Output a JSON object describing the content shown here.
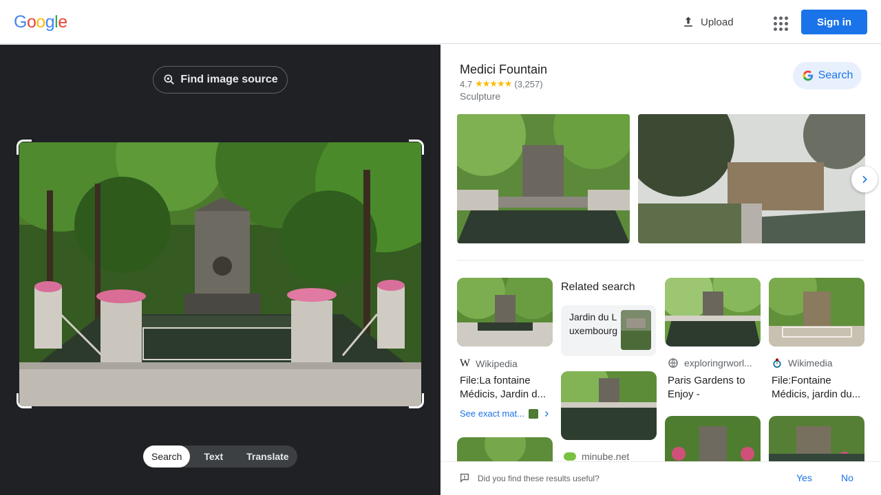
{
  "header": {
    "logo": "Google",
    "upload_label": "Upload",
    "signin_label": "Sign in"
  },
  "left": {
    "find_source_label": "Find image source",
    "modes": [
      "Search",
      "Text",
      "Translate"
    ],
    "active_mode": "Search"
  },
  "knowledge_panel": {
    "title": "Medici Fountain",
    "rating": "4.7",
    "stars": "★★★★★",
    "review_count": "(3,257)",
    "type": "Sculpture",
    "search_label": "Search"
  },
  "results": {
    "col1": {
      "source": "Wikipedia",
      "title_line1": "File:La fontaine",
      "title_line2": "Médicis, Jardin d...",
      "see_exact": "See exact mat..."
    },
    "related": {
      "heading": "Related search",
      "card_text": "Jardin du Luxembourg"
    },
    "col2_bottom_source": "minube.net",
    "col3": {
      "source": "exploringrworl...",
      "title_line1": "Paris Gardens to",
      "title_line2": "Enjoy -"
    },
    "col4": {
      "source": "Wikimedia",
      "title_line1": "File:Fontaine",
      "title_line2": "Médicis, jardin du..."
    }
  },
  "feedback": {
    "question": "Did you find these results useful?",
    "yes": "Yes",
    "no": "No"
  },
  "colors": {
    "accent": "#1a73e8",
    "dark_panel": "#202124",
    "star": "#fbbc04"
  }
}
